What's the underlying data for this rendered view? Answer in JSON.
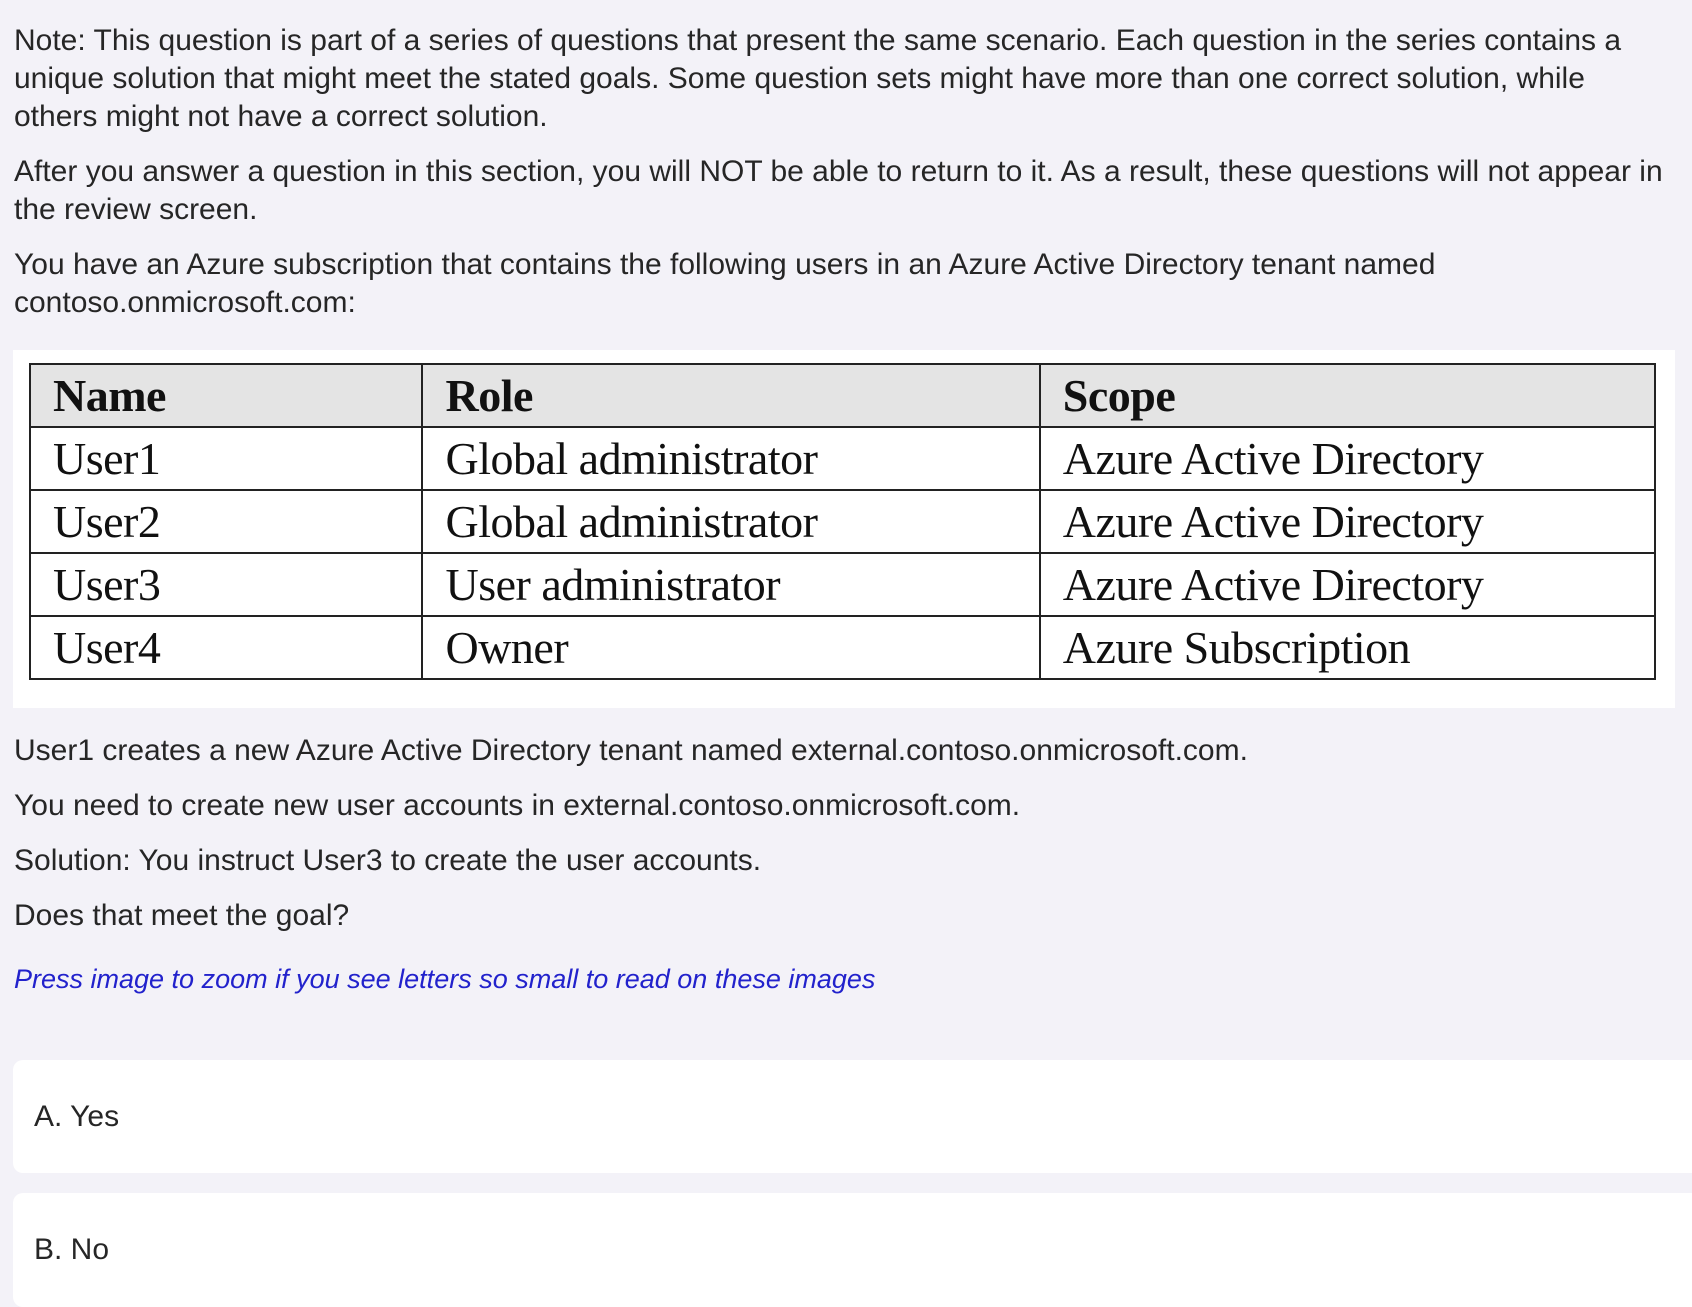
{
  "question": {
    "paragraphs": [
      "Note: This question is part of a series of questions that present the same scenario. Each question in the series contains a unique solution that might meet the stated goals. Some question sets might have more than one correct solution, while others might not have a correct solution.",
      "After you answer a question in this section, you will NOT be able to return to it. As a result, these questions will not appear in the review screen.",
      "You have an Azure subscription that contains the following users in an Azure Active Directory tenant named contoso.onmicrosoft.com:"
    ],
    "table": {
      "headers": [
        "Name",
        "Role",
        "Scope"
      ],
      "rows": [
        [
          "User1",
          "Global administrator",
          "Azure Active Directory"
        ],
        [
          "User2",
          "Global administrator",
          "Azure Active Directory"
        ],
        [
          "User3",
          "User administrator",
          "Azure Active Directory"
        ],
        [
          "User4",
          "Owner",
          "Azure Subscription"
        ]
      ]
    },
    "after_table": [
      "User1 creates a new Azure Active Directory tenant named external.contoso.onmicrosoft.com.",
      "You need to create new user accounts in external.contoso.onmicrosoft.com.",
      "Solution: You instruct User3 to create the user accounts.",
      "Does that meet the goal?"
    ],
    "zoom_hint": "Press image to zoom if you see letters so small to read on these images"
  },
  "options": [
    {
      "label": "A. Yes"
    },
    {
      "label": "B. No"
    }
  ],
  "colors": {
    "page_background": "#f3f2f8",
    "hint_text": "#2222cc",
    "card_background": "#ffffff",
    "table_header_background": "#e4e4e4"
  }
}
